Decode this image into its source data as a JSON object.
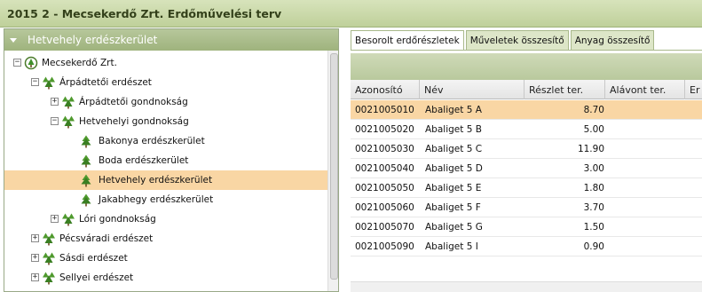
{
  "title": "2015 2 - Mecsekerdő Zrt. Erdőművelési terv",
  "left_panel": {
    "header": "Hetvehely erdészkerület",
    "tree": [
      {
        "label": "Mecsekerdő Zrt.",
        "level": 0,
        "expander": "−",
        "icon": "company-icon",
        "selected": false
      },
      {
        "label": "Árpádtetői erdészet",
        "level": 1,
        "expander": "−",
        "icon": "forestry-icon",
        "selected": false
      },
      {
        "label": "Árpádtetői gondnokság",
        "level": 2,
        "expander": "+",
        "icon": "forestry-icon",
        "selected": false
      },
      {
        "label": "Hetvehelyi gondnokság",
        "level": 2,
        "expander": "−",
        "icon": "forestry-icon",
        "selected": false
      },
      {
        "label": "Bakonya erdészkerület",
        "level": 3,
        "expander": "",
        "icon": "tree-icon",
        "selected": false
      },
      {
        "label": "Boda erdészkerület",
        "level": 3,
        "expander": "",
        "icon": "tree-icon",
        "selected": false
      },
      {
        "label": "Hetvehely erdészkerület",
        "level": 3,
        "expander": "",
        "icon": "tree-icon",
        "selected": true
      },
      {
        "label": "Jakabhegy erdészkerület",
        "level": 3,
        "expander": "",
        "icon": "tree-icon",
        "selected": false
      },
      {
        "label": "Lóri gondnokság",
        "level": 2,
        "expander": "+",
        "icon": "forestry-icon",
        "selected": false
      },
      {
        "label": "Pécsváradi erdészet",
        "level": 1,
        "expander": "+",
        "icon": "forestry-icon",
        "selected": false
      },
      {
        "label": "Sásdi erdészet",
        "level": 1,
        "expander": "+",
        "icon": "forestry-icon",
        "selected": false
      },
      {
        "label": "Sellyei erdészet",
        "level": 1,
        "expander": "+",
        "icon": "forestry-icon",
        "selected": false
      }
    ]
  },
  "tabs": [
    {
      "label": "Besorolt erdőrészletek",
      "active": true
    },
    {
      "label": "Műveletek összesítő",
      "active": false
    },
    {
      "label": "Anyag összesítő",
      "active": false
    }
  ],
  "grid": {
    "columns": [
      "Azonosító",
      "Név",
      "Részlet ter.",
      "Alávont ter.",
      "Er"
    ],
    "rows": [
      {
        "id": "0021005010",
        "nev": "Abaliget 5 A",
        "reszlet": "8.70",
        "selected": true
      },
      {
        "id": "0021005020",
        "nev": "Abaliget 5 B",
        "reszlet": "5.00",
        "selected": false
      },
      {
        "id": "0021005030",
        "nev": "Abaliget 5 C",
        "reszlet": "11.90",
        "selected": false
      },
      {
        "id": "0021005040",
        "nev": "Abaliget 5 D",
        "reszlet": "3.00",
        "selected": false
      },
      {
        "id": "0021005050",
        "nev": "Abaliget 5 E",
        "reszlet": "1.80",
        "selected": false
      },
      {
        "id": "0021005060",
        "nev": "Abaliget 5 F",
        "reszlet": "3.70",
        "selected": false
      },
      {
        "id": "0021005070",
        "nev": "Abaliget 5 G",
        "reszlet": "1.50",
        "selected": false
      },
      {
        "id": "0021005090",
        "nev": "Abaliget 5 I",
        "reszlet": "0.90",
        "selected": false
      }
    ]
  },
  "colors": {
    "title_bar": "#c9d7a9",
    "panel_header": "#a9bb88",
    "selection": "#f9d6a4",
    "toolbar": "#c3d1a6"
  }
}
